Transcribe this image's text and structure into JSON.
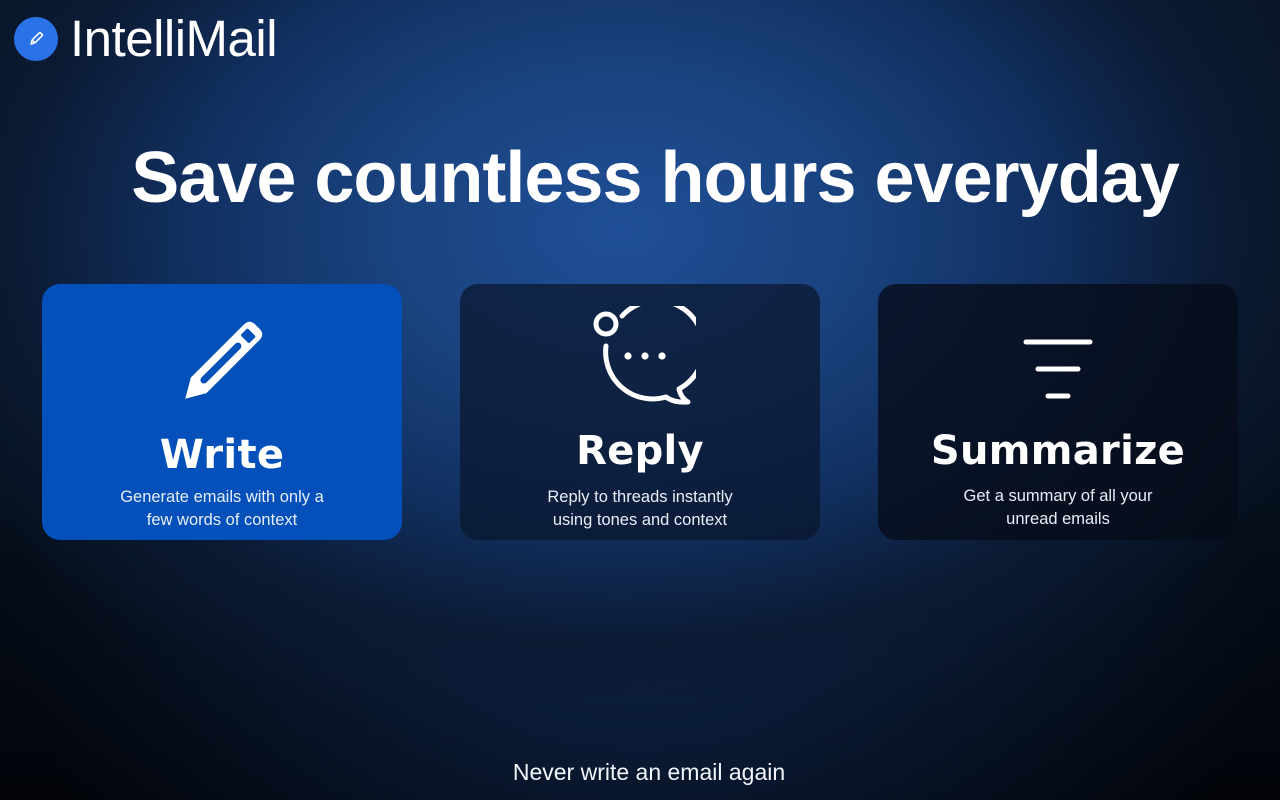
{
  "brand": {
    "name": "IntelliMail",
    "icon": "pencil-icon",
    "badge_color": "#2a72e8"
  },
  "hero": {
    "headline": "Save countless hours everyday"
  },
  "features": [
    {
      "title": "Write",
      "description_line1": "Generate emails with only a",
      "description_line2": "few words of context",
      "icon": "pencil-icon",
      "background": "#0350ba",
      "active": true
    },
    {
      "title": "Reply",
      "description_line1": "Reply to threads instantly",
      "description_line2": "using tones and context",
      "icon": "chat-bubble-icon",
      "active": false
    },
    {
      "title": "Summarize",
      "description_line1": "Get a summary of all your",
      "description_line2": "unread emails",
      "icon": "filter-lines-icon",
      "active": false
    }
  ],
  "footer": {
    "tagline": "Never write an email again"
  }
}
